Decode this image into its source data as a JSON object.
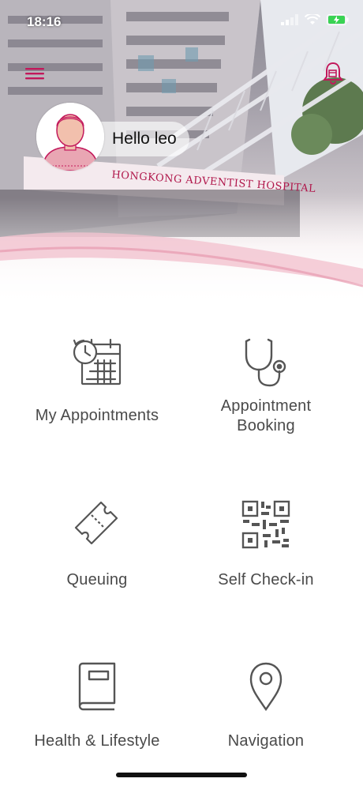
{
  "status_bar": {
    "time": "18:16"
  },
  "header": {
    "greeting": "Hello leo",
    "building_sign": "HONGKONG ADVENTIST HOSPITAL"
  },
  "tiles": [
    {
      "label": "My Appointments",
      "icon": "calendar-clock-icon"
    },
    {
      "label": "Appointment\nBooking",
      "icon": "stethoscope-icon"
    },
    {
      "label": "Queuing",
      "icon": "ticket-icon"
    },
    {
      "label": "Self Check-in",
      "icon": "qr-code-icon"
    },
    {
      "label": "Health & Lifestyle",
      "icon": "book-icon"
    },
    {
      "label": "Navigation",
      "icon": "location-pin-icon"
    }
  ],
  "colors": {
    "accent": "#c2185b",
    "icon_gray": "#555555",
    "label_gray": "#4a4a4a"
  }
}
